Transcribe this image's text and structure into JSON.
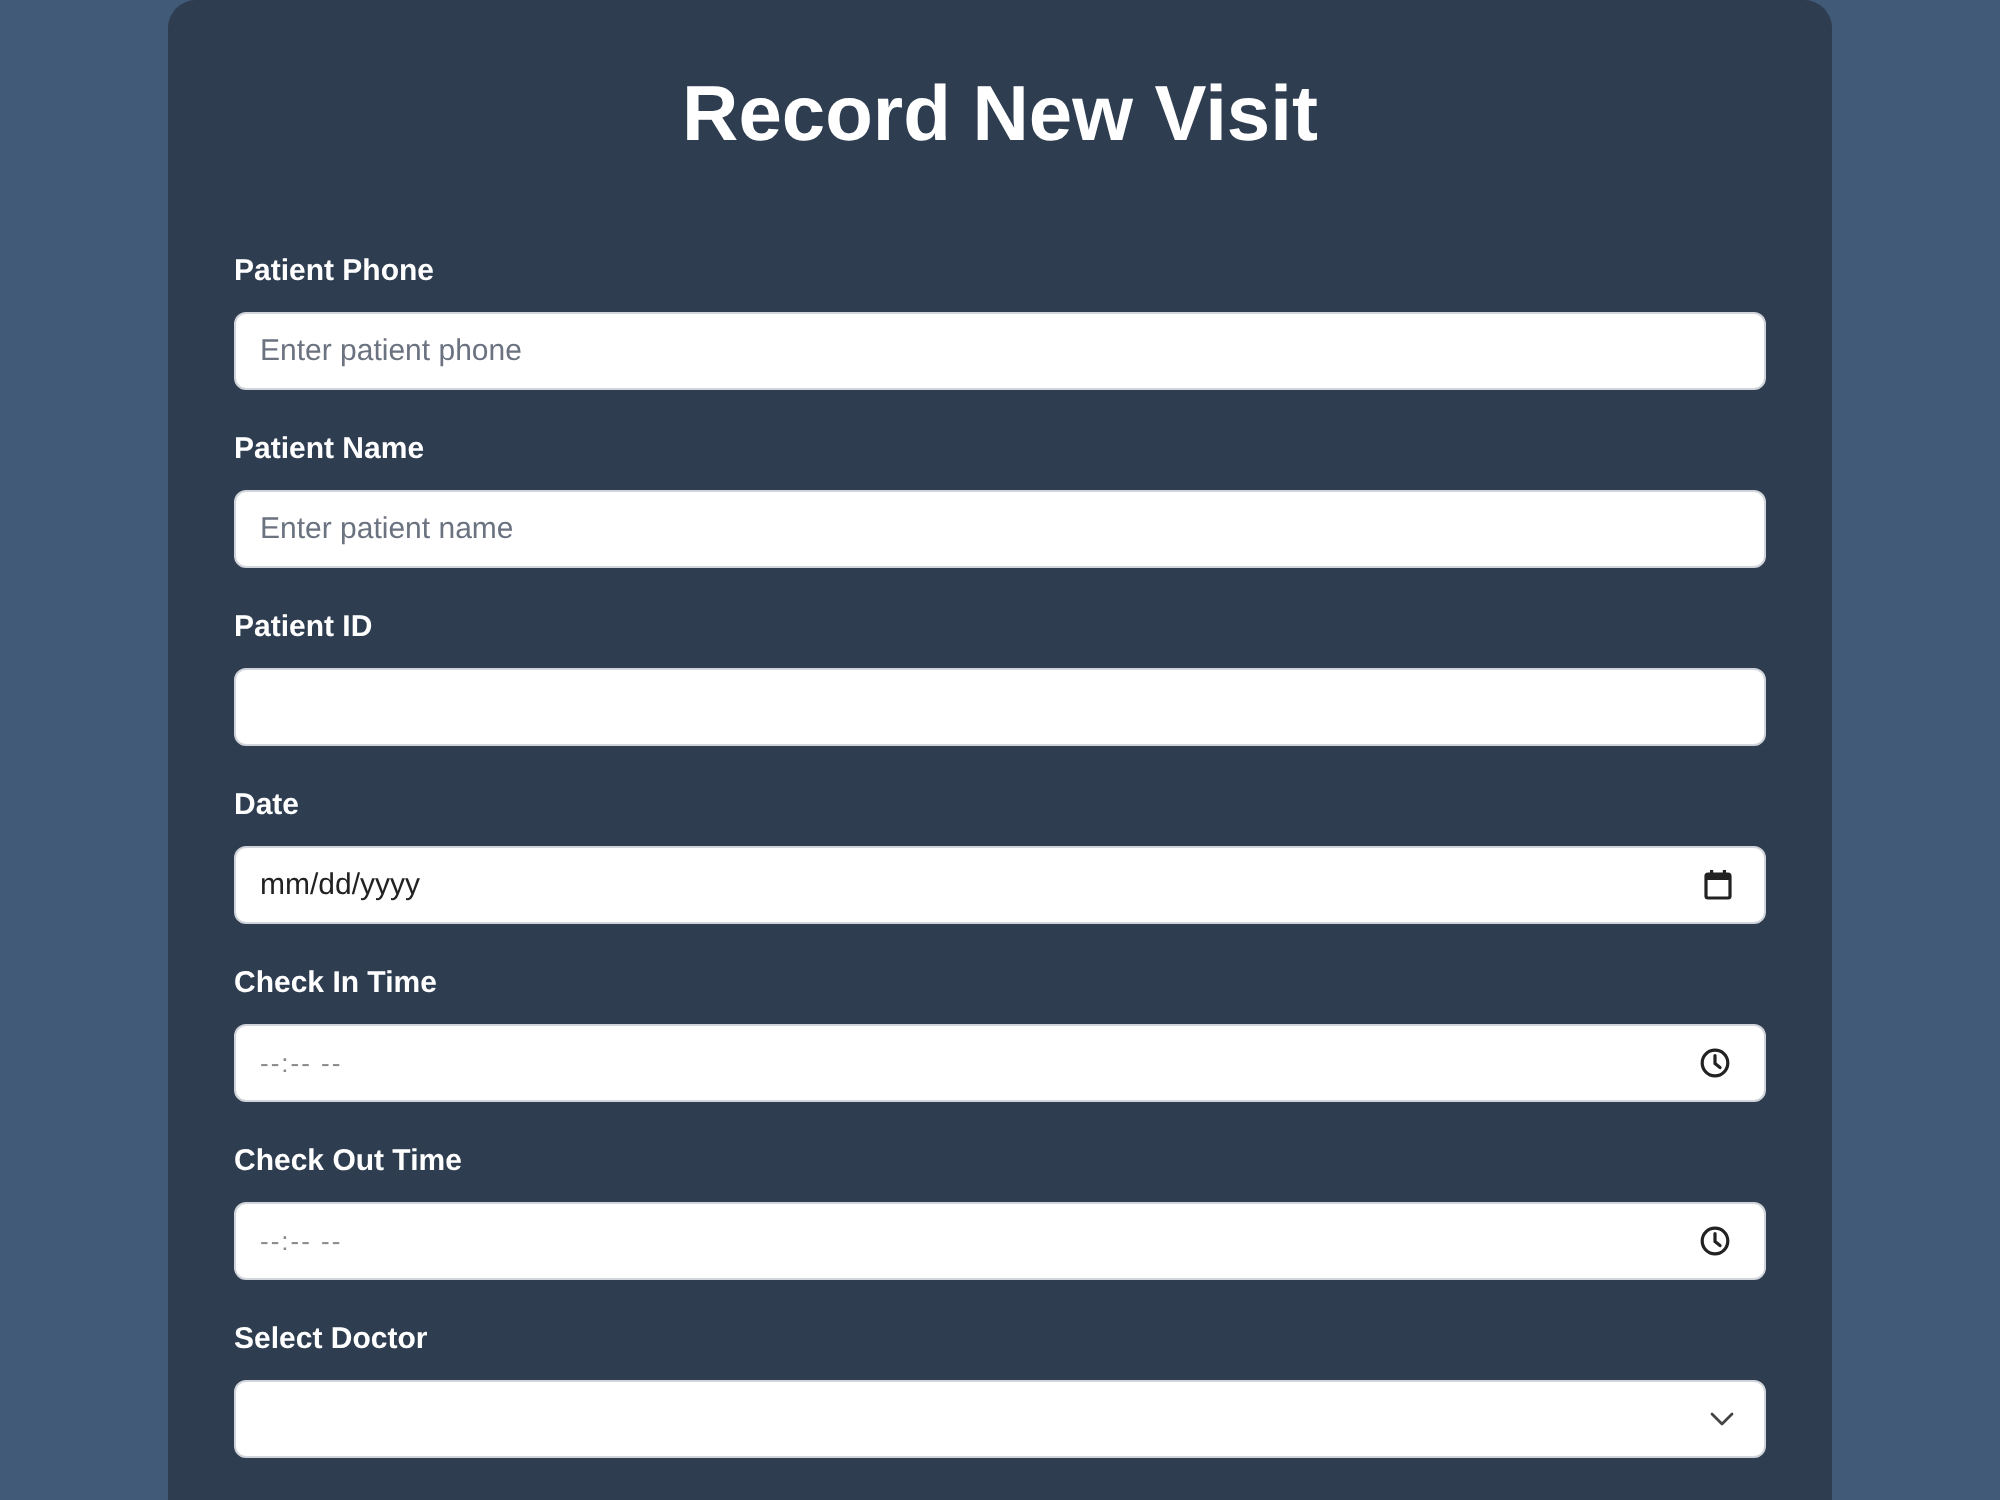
{
  "form": {
    "title": "Record New Visit",
    "fields": [
      {
        "label": "Patient Phone",
        "kind": "text",
        "placeholder": "Enter patient phone"
      },
      {
        "label": "Patient Name",
        "kind": "text",
        "placeholder": "Enter patient name"
      },
      {
        "label": "Patient ID",
        "kind": "text"
      },
      {
        "label": "Date",
        "kind": "date",
        "placeholder": "mm/dd/yyyy"
      },
      {
        "label": "Check In Time",
        "kind": "time",
        "placeholder": "--:-- --"
      },
      {
        "label": "Check Out Time",
        "kind": "time",
        "placeholder": "--:-- --"
      },
      {
        "label": "Select Doctor",
        "kind": "select"
      }
    ]
  }
}
